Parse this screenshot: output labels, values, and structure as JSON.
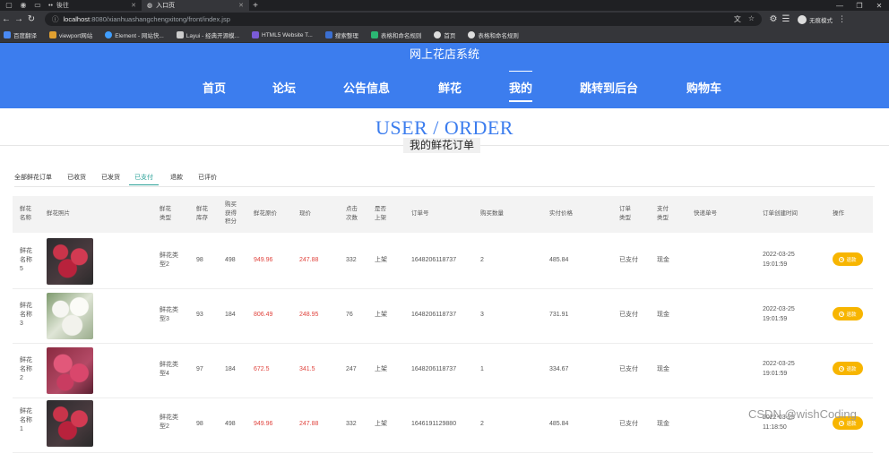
{
  "browser": {
    "tabs": [
      {
        "title": "後往",
        "active": false
      },
      {
        "title": "入口页",
        "active": true
      }
    ],
    "url_host": "localhost",
    "url_path": ":8080/xianhuashangchengxitong/front/index.jsp",
    "profile_label": "无痕模式",
    "bookmarks": [
      "百度翻译",
      "viewport网站",
      "Element - 网站快...",
      "Layui - 经典开源模...",
      "HTML5 Website T...",
      "搜索整理",
      "表格和命名规则",
      "首页",
      "表格和命名规则"
    ]
  },
  "site": {
    "title": "网上花店系统",
    "nav": [
      "首页",
      "论坛",
      "公告信息",
      "鲜花",
      "我的",
      "跳转到后台",
      "购物车"
    ],
    "active_nav": "我的"
  },
  "page": {
    "heading": "USER / ORDER",
    "subheading": "我的鲜花订单",
    "status_tabs": [
      "全部鲜花订单",
      "已收货",
      "已发货",
      "已支付",
      "退款",
      "已评价"
    ],
    "active_tab": "已支付"
  },
  "table": {
    "headers": {
      "name": "鲜花名称",
      "photo": "鲜花照片",
      "type": "鲜花类型",
      "stock": "鲜花库存",
      "points": "购买获得积分",
      "original_price": "鲜花原价",
      "price": "现价",
      "clicks": "点击次数",
      "on_sale": "是否上架",
      "order_no": "订单号",
      "qty": "购买数量",
      "paid": "实付价格",
      "order_type": "订单类型",
      "pay_type": "支付类型",
      "express_no": "快递单号",
      "created": "订单创建时间",
      "action": "操作"
    },
    "rows": [
      {
        "name": "鲜花名称5",
        "photo": "red",
        "type": "鲜花类型2",
        "stock": "98",
        "points": "498",
        "original_price": "949.96",
        "price": "247.88",
        "clicks": "332",
        "on_sale": "上架",
        "order_no": "1648206118737",
        "qty": "2",
        "paid": "485.84",
        "order_type": "已支付",
        "pay_type": "现金",
        "express_no": "",
        "created_date": "2022-03-25",
        "created_time": "19:01:59",
        "action": "退款"
      },
      {
        "name": "鲜花名称3",
        "photo": "white",
        "type": "鲜花类型3",
        "stock": "93",
        "points": "184",
        "original_price": "806.49",
        "price": "248.95",
        "clicks": "76",
        "on_sale": "上架",
        "order_no": "1648206118737",
        "qty": "3",
        "paid": "731.91",
        "order_type": "已支付",
        "pay_type": "现金",
        "express_no": "",
        "created_date": "2022-03-25",
        "created_time": "19:01:59",
        "action": "退款"
      },
      {
        "name": "鲜花名称2",
        "photo": "pink",
        "type": "鲜花类型4",
        "stock": "97",
        "points": "184",
        "original_price": "672.5",
        "price": "341.5",
        "clicks": "247",
        "on_sale": "上架",
        "order_no": "1648206118737",
        "qty": "1",
        "paid": "334.67",
        "order_type": "已支付",
        "pay_type": "现金",
        "express_no": "",
        "created_date": "2022-03-25",
        "created_time": "19:01:59",
        "action": "退款"
      },
      {
        "name": "鲜花名称1",
        "photo": "red",
        "type": "鲜花类型2",
        "stock": "98",
        "points": "498",
        "original_price": "949.96",
        "price": "247.88",
        "clicks": "332",
        "on_sale": "上架",
        "order_no": "1646191129880",
        "qty": "2",
        "paid": "485.84",
        "order_type": "已支付",
        "pay_type": "现金",
        "express_no": "",
        "created_date": "2022-03-25",
        "created_time": "11:18:50",
        "action": "退款"
      }
    ]
  },
  "watermark": "CSDN @wishCoding",
  "colors": {
    "brand_blue": "#3c7dee",
    "accent_teal": "#2aa198",
    "price_red": "#e0443e",
    "button_yellow": "#f7b500"
  }
}
